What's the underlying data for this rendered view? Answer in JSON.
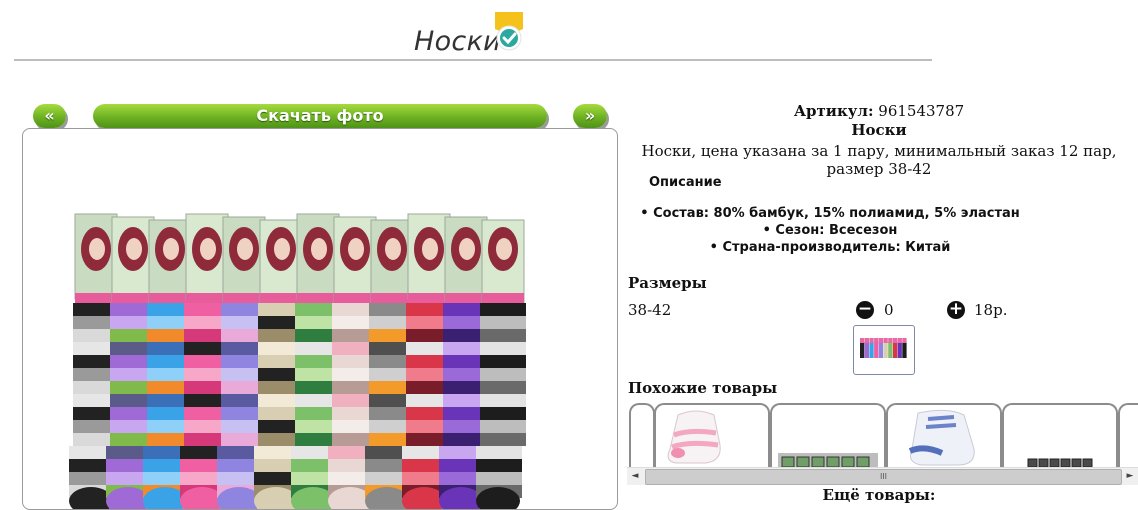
{
  "header": {
    "title": "Носки"
  },
  "nav": {
    "prev_label": "«",
    "next_label": "»",
    "download_label": "Скачать фото"
  },
  "product": {
    "article_label": "Артикул:",
    "article_value": "961543787",
    "name": "Носки",
    "short_desc": "Носки, цена указана за 1 пару, минимальный заказ 12 пар, размер 38-42"
  },
  "description": {
    "heading": "Описание",
    "items": [
      "Состав: 80% бамбук, 15% полиамид, 5% эластан",
      "Сезон: Всесезон",
      "Страна-производитель: Китай"
    ]
  },
  "sizes": {
    "heading": "Размеры",
    "rows": [
      {
        "size": "38-42",
        "minus": "−",
        "quantity": "0",
        "plus": "+",
        "price": "18р."
      }
    ]
  },
  "similar": {
    "heading": "Похожие товары",
    "scroll_thumb": "III",
    "scroll_left": "◄",
    "scroll_right": "►"
  },
  "more": {
    "heading": "Ещё товары:"
  },
  "colors": {
    "accent_green": "#6db223",
    "badge_yellow": "#f4c21a",
    "badge_teal": "#2aa9a1"
  }
}
